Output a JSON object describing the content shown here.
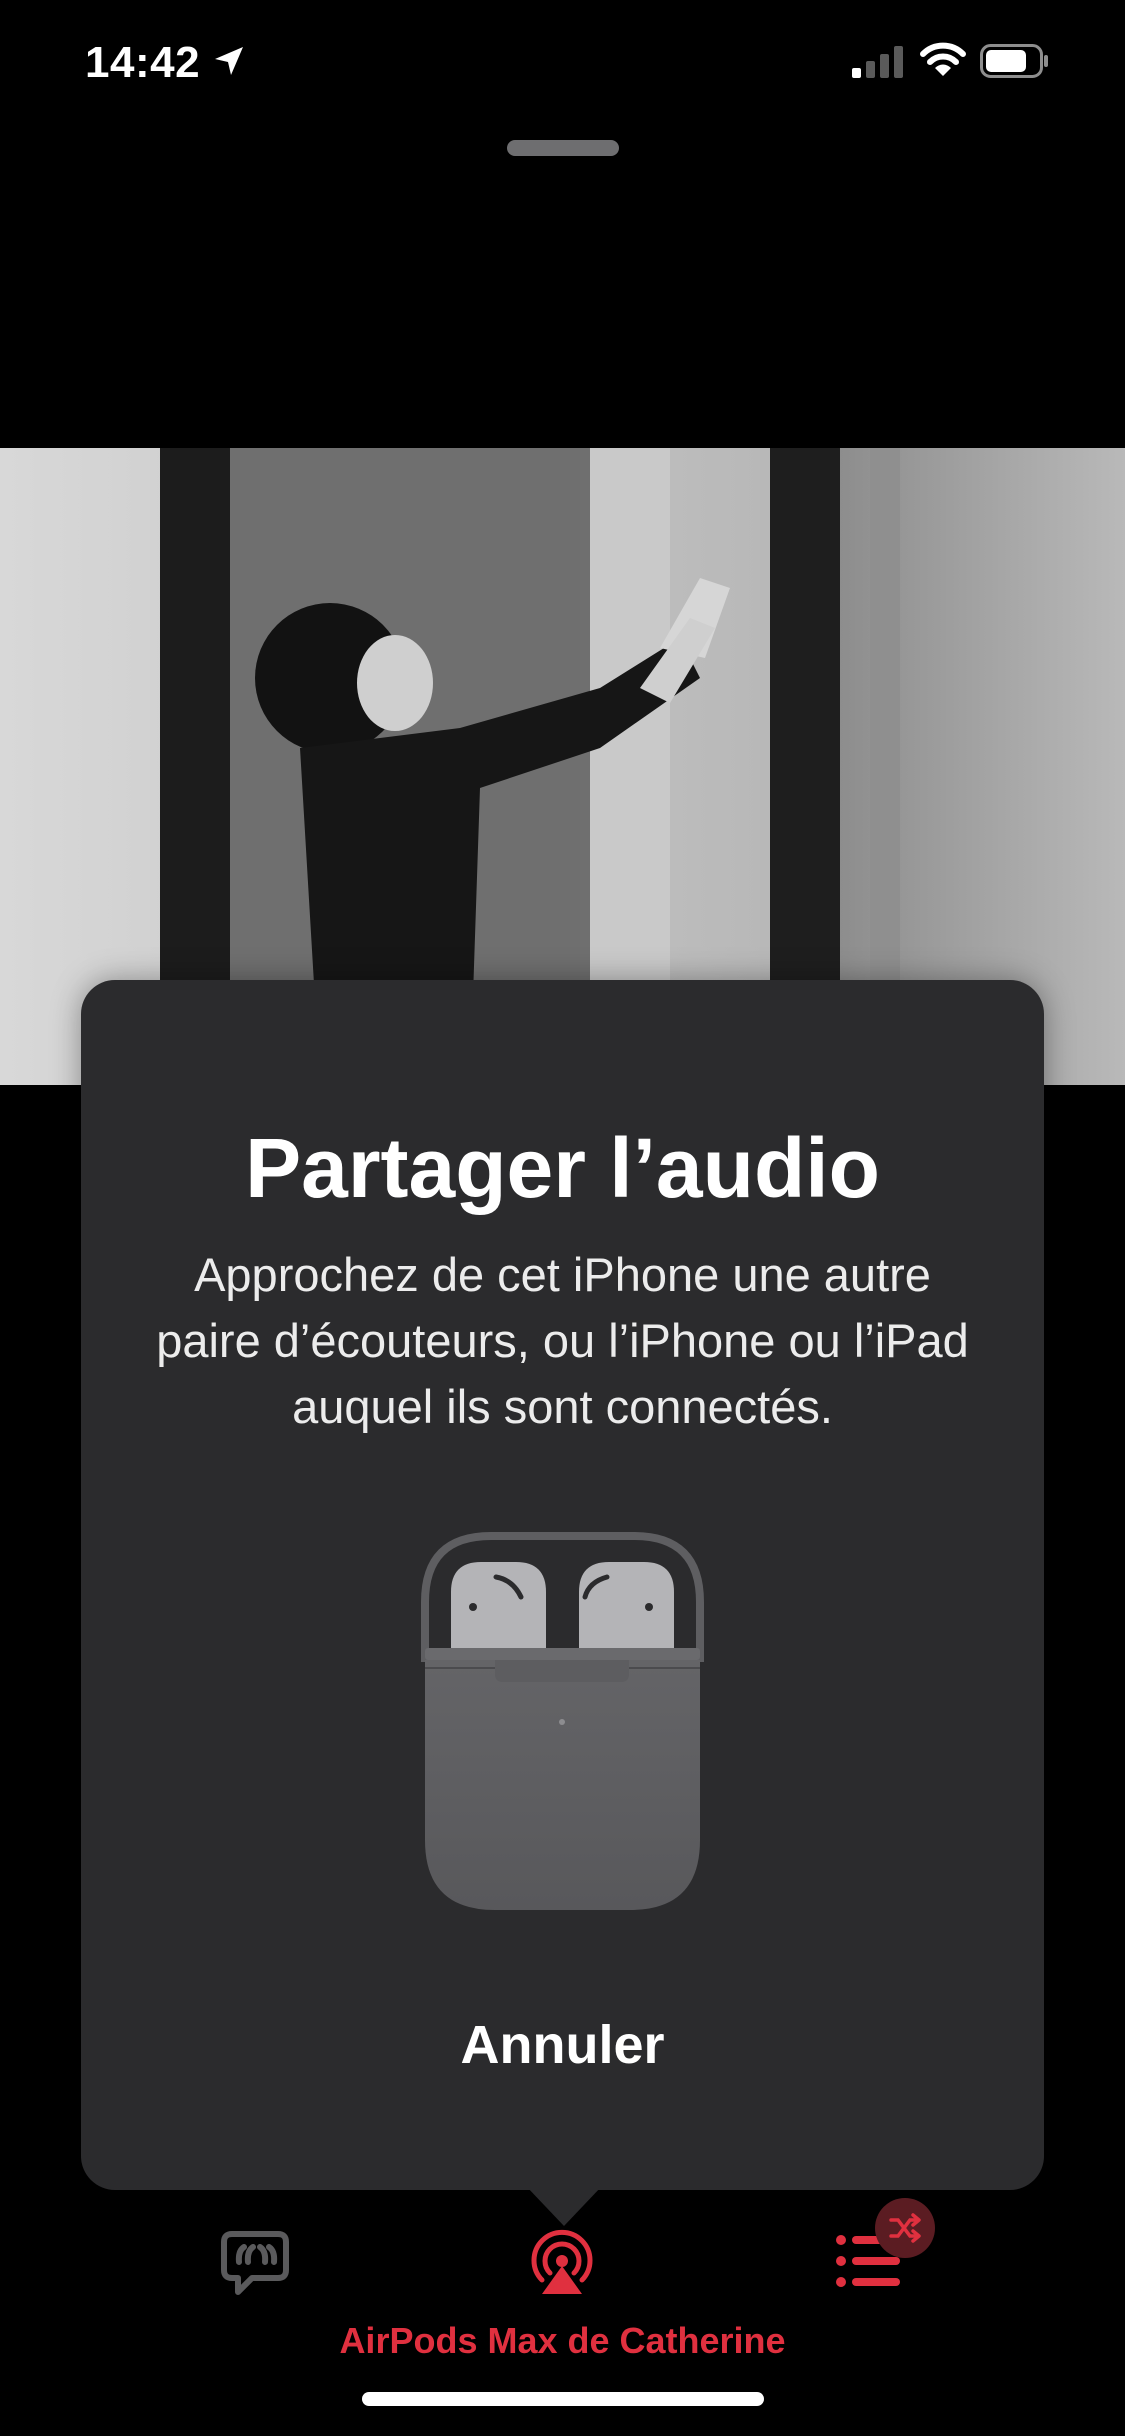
{
  "status_bar": {
    "time": "14:42",
    "icons": [
      "location-arrow-icon",
      "cellular-signal-icon",
      "wifi-icon",
      "battery-icon"
    ]
  },
  "share_audio_sheet": {
    "title": "Partager l’audio",
    "body": "Approchez de cet iPhone une autre paire d’écouteurs, ou l’iPhone ou l’iPad auquel ils sont connectés.",
    "illustration": "airpods-case-icon",
    "cancel_label": "Annuler"
  },
  "player_controls": {
    "lyrics_icon": "lyrics-icon",
    "airplay_icon": "airplay-audio-icon",
    "queue_icon": "queue-list-icon",
    "shuffle_badge_icon": "shuffle-icon",
    "output_device_label": "AirPods Max de Catherine"
  },
  "colors": {
    "accent": "#e0303f",
    "sheet_background": "#2b2b2d",
    "background": "#000000"
  }
}
